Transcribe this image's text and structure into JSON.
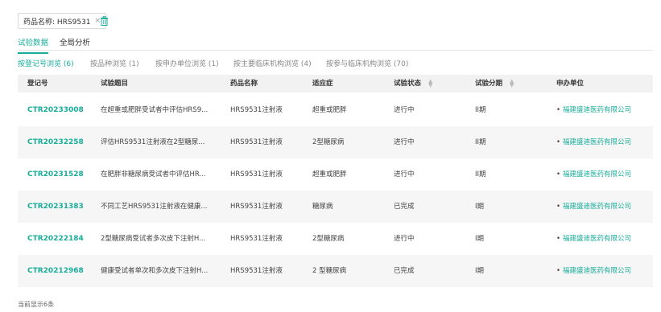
{
  "filter": {
    "tag_label": "药品名称: HRS9531",
    "close_glyph": "×"
  },
  "main_tabs": [
    {
      "label": "试验数据"
    },
    {
      "label": "全局分析"
    }
  ],
  "sub_tabs": [
    {
      "label": "按登记号浏览 (6)"
    },
    {
      "label": "按品种浏览 (1)"
    },
    {
      "label": "按申办单位浏览 (1)"
    },
    {
      "label": "按主要临床机构浏览 (4)"
    },
    {
      "label": "按参与临床机构浏览 (70)"
    }
  ],
  "table": {
    "columns": [
      {
        "label": "登记号"
      },
      {
        "label": "试验题目"
      },
      {
        "label": "药品名称"
      },
      {
        "label": "适应症"
      },
      {
        "label": "试验状态"
      },
      {
        "label": "试验分期"
      },
      {
        "label": "申办单位"
      }
    ],
    "rows": [
      {
        "reg": "CTR20233008",
        "title": "在超重或肥胖受试者中评估HRS9...",
        "drug": "HRS9531注射液",
        "indication": "超重或肥胖",
        "status": "进行中",
        "phase": "II期",
        "sponsor": "福建盛迪医药有限公司"
      },
      {
        "reg": "CTR20232258",
        "title": "评估HRS9531注射液在2型糖尿...",
        "drug": "HRS9531注射液",
        "indication": "2型糖尿病",
        "status": "进行中",
        "phase": "II期",
        "sponsor": "福建盛迪医药有限公司"
      },
      {
        "reg": "CTR20231528",
        "title": "在肥胖非糖尿病受试者中评估HR...",
        "drug": "HRS9531注射液",
        "indication": "超重或肥胖",
        "status": "进行中",
        "phase": "II期",
        "sponsor": "福建盛迪医药有限公司"
      },
      {
        "reg": "CTR20231383",
        "title": "不同工艺HRS9531注射液在健康...",
        "drug": "HRS9531注射液",
        "indication": "糖尿病",
        "status": "已完成",
        "phase": "I期",
        "sponsor": "福建盛迪医药有限公司"
      },
      {
        "reg": "CTR20222184",
        "title": "2型糖尿病受试者多次皮下注射H...",
        "drug": "HRS9531注射液",
        "indication": "2型糖尿病",
        "status": "进行中",
        "phase": "I期",
        "sponsor": "福建盛迪医药有限公司"
      },
      {
        "reg": "CTR20212968",
        "title": "健康受试者单次和多次皮下注射H...",
        "drug": "HRS9531注射液",
        "indication": "2 型糖尿病",
        "status": "已完成",
        "phase": "I期",
        "sponsor": "福建盛迪医药有限公司"
      }
    ]
  },
  "footer": {
    "count_text": "当前显示6条"
  },
  "colors": {
    "accent": "#1aad9a",
    "header_bg": "#f2f2f2",
    "alt_row_bg": "#f6f6f6"
  }
}
